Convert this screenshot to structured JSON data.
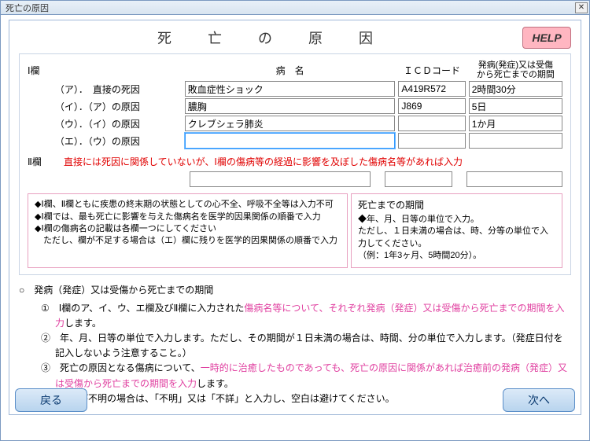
{
  "window": {
    "title": "死亡の原因"
  },
  "header": {
    "title": "死　亡　の　原　因",
    "help": "HELP"
  },
  "columns": {
    "section1": "Ⅰ欄",
    "disease": "病　名",
    "icd": "ＩＣＤコード",
    "period_l1": "発病(発症)又は受傷",
    "period_l2": "から死亡までの期間"
  },
  "rows": {
    "a": {
      "label": "（ア）．　直接の死因",
      "disease": "敗血症性ショック",
      "icd": "A419R572",
      "period": "2時間30分"
    },
    "i": {
      "label": "（イ）．（ア）の原因",
      "disease": "膿胸",
      "icd": "J869",
      "period": "5日"
    },
    "u": {
      "label": "（ウ）．（イ）の原因",
      "disease": "クレブシェラ肺炎",
      "icd": "",
      "period": "1か月"
    },
    "e": {
      "label": "（エ）．（ウ）の原因",
      "disease": "",
      "icd": "",
      "period": ""
    }
  },
  "section2": {
    "label": "Ⅱ欄",
    "note": "直接には死因に関係していないが、Ⅰ欄の傷病等の経過に影響を及ぼした傷病名等があれば入力",
    "disease": "",
    "icd": "",
    "period": ""
  },
  "leftbox": {
    "l1": "◆Ⅰ欄、Ⅱ欄ともに疾患の終末期の状態としての心不全、呼吸不全等は入力不可",
    "l2": "◆Ⅰ欄では、最も死亡に影響を与えた傷病名を医学的因果関係の順番で入力",
    "l3": "◆Ⅰ欄の傷病名の記載は各欄一つにしてください",
    "l4": "　ただし、欄が不足する場合は（エ）欄に残りを医学的因果関係の順番で入力"
  },
  "rightbox": {
    "title": "死亡までの期間",
    "l1": "◆年、月、日等の単位で入力。",
    "l2": "ただし、１日未満の場合は、時、分等の単位で入力してください。",
    "l3": "（例：1年3ヶ月、5時間20分）。"
  },
  "lower": {
    "head": "○　発病（発症）又は受傷から死亡までの期間",
    "i1a": "①　Ⅰ欄のア、イ、ウ、エ欄及びⅡ欄に入力された",
    "i1b": "傷病名等について、それぞれ発病（発症）又は受傷から死亡までの期間を入力",
    "i1c": "します。",
    "i2": "②　年、月、日等の単位で入力します。ただし、その期間が１日未満の場合は、時間、分の単位で入力します。（発症日付を記入しないよう注意すること。）",
    "i3a": "③　死亡の原因となる傷病について、",
    "i3b": "一時的に治癒したものであっても、死亡の原因に関係があれば治癒前の発病（発症）又は受傷から死亡までの期間を入力",
    "i3c": "します。",
    "i4": "④　期間が不明の場合は、「不明」又は「不詳」と入力し、空白は避けてください。"
  },
  "nav": {
    "back": "戻る",
    "next": "次へ"
  }
}
